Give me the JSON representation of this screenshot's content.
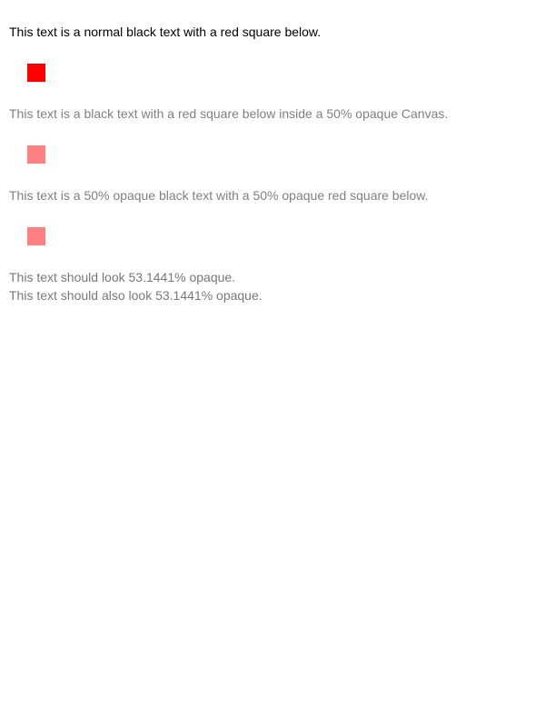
{
  "sections": [
    {
      "text": "This text is a normal black text with a red square below.",
      "text_color": "#000000",
      "square_color": "#ff0000"
    },
    {
      "text": "This text is a black text with a red square below inside a 50% opaque Canvas.",
      "text_color": "#808080",
      "square_color": "#ff8080"
    },
    {
      "text": "This text is a 50% opaque black text with a 50% opaque red square below.",
      "text_color": "#808080",
      "square_color": "#ff8080"
    }
  ],
  "final_lines": [
    {
      "text": "This text should look 53.1441% opaque.",
      "text_color": "#787878"
    },
    {
      "text": "This text should also look 53.1441% opaque.",
      "text_color": "#787878"
    }
  ]
}
